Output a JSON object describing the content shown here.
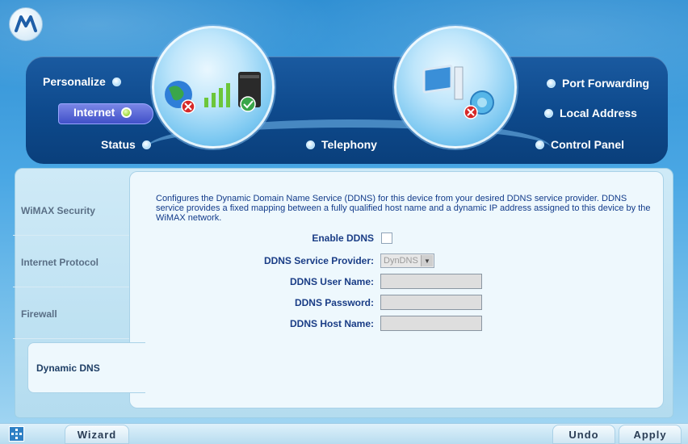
{
  "nav": {
    "personalize": "Personalize",
    "internet": "Internet",
    "status": "Status",
    "telephony": "Telephony",
    "port_forwarding": "Port Forwarding",
    "local_address": "Local Address",
    "control_panel": "Control Panel"
  },
  "sidebar": {
    "items": [
      {
        "label": "WiMAX Security"
      },
      {
        "label": "Internet Protocol"
      },
      {
        "label": "Firewall"
      },
      {
        "label": "Dynamic DNS"
      }
    ],
    "active": "Dynamic DNS"
  },
  "main": {
    "description": "Configures the Dynamic Domain Name Service (DDNS) for this device from your desired DDNS service provider. DDNS service provides a fixed mapping between a fully qualified host name and a dynamic IP address assigned to this device by the WiMAX network.",
    "enable_label": "Enable DDNS",
    "enable_checked": false,
    "provider_label": "DDNS Service Provider:",
    "provider_value": "DynDNS",
    "username_label": "DDNS User Name:",
    "username_value": "",
    "password_label": "DDNS Password:",
    "password_value": "",
    "hostname_label": "DDNS Host Name:",
    "hostname_value": ""
  },
  "footer": {
    "wizard": "Wizard",
    "undo": "Undo",
    "apply": "Apply"
  },
  "colors": {
    "nav_band": "#0e4a8d",
    "label_text": "#1a3d86",
    "active_dot": "#a9dd4a"
  }
}
